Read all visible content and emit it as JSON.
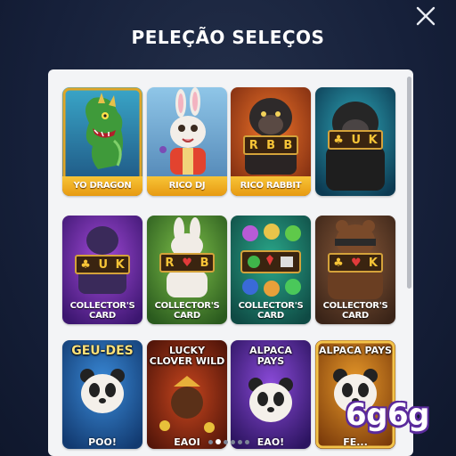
{
  "modal": {
    "title": "PELEÇÃO SELEÇOS"
  },
  "games": [
    {
      "label": "YO DRAGON"
    },
    {
      "label": "RICO DJ"
    },
    {
      "label": "RICO RABBIT",
      "reel": [
        "R",
        "B",
        "B"
      ]
    },
    {
      "label": "",
      "reel": [
        "♣",
        "U",
        "K"
      ]
    },
    {
      "label": "COLLECTOR'S CARD",
      "line1": "COLLECTOR'S",
      "line2": "CARD",
      "reel": [
        "♣",
        "U",
        "K"
      ]
    },
    {
      "label": "COLLECTOR'S CARD",
      "line1": "COLLECTOR'S",
      "line2": "CARD",
      "reel": [
        "R",
        "♥",
        "B"
      ]
    },
    {
      "label": "COLLECTOR'S CARD",
      "line1": "COLLECTOR'S",
      "line2": "CARD"
    },
    {
      "label": "COLLECTOR'S CARD",
      "line1": "COLLECTOR'S",
      "line2": "CARD",
      "reel": [
        "♣",
        "♥",
        "K"
      ]
    },
    {
      "title": "GEU-DES",
      "label": "POO!"
    },
    {
      "title": "LUCKY CLOVER WILD",
      "title1": "LUCKY",
      "title2": "CLOVER WILD",
      "label": "EAOI"
    },
    {
      "title": "ALPACA PAYS",
      "title1": "ALPACA",
      "title2": "PAYS",
      "label": "EAO!"
    },
    {
      "title": "ALPACA PAYS",
      "label": "FE..."
    }
  ],
  "watermark": "6g6g",
  "pagination": {
    "count": 6,
    "active": 1
  },
  "colors": {
    "background": "#16203a",
    "panel": "#f3f4f6",
    "label_bar": "#f0b02a",
    "watermark_outline": "#5a2a9c"
  }
}
